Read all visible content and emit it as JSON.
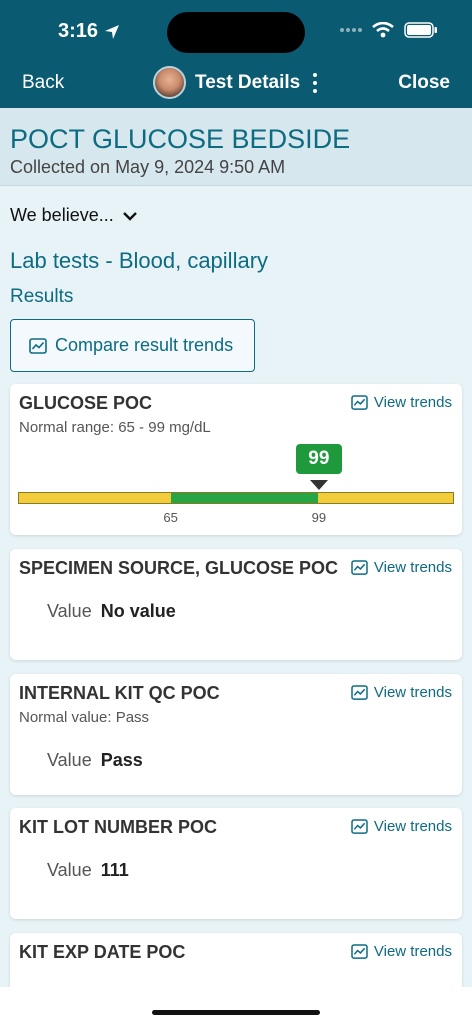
{
  "status_bar": {
    "time": "3:16"
  },
  "nav": {
    "back_label": "Back",
    "title": "Test Details",
    "close_label": "Close"
  },
  "header": {
    "title": "POCT GLUCOSE BEDSIDE",
    "collected": "Collected on May 9, 2024 9:50 AM"
  },
  "believe_label": "We believe...",
  "section_title": "Lab tests - Blood, capillary",
  "results_label": "Results",
  "compare_button_label": "Compare result trends",
  "view_trends_label": "View trends",
  "value_label": "Value",
  "cards": [
    {
      "title": "GLUCOSE POC",
      "subtitle": "Normal range: 65 - 99 mg/dL",
      "result": "99",
      "range_low": "65",
      "range_high": "99",
      "scale": {
        "min": 30,
        "max": 130,
        "low": 65,
        "high": 99,
        "value": 99
      }
    },
    {
      "title": "SPECIMEN SOURCE, GLUCOSE POC",
      "value": "No value"
    },
    {
      "title": "INTERNAL KIT QC POC",
      "subtitle": "Normal value: Pass",
      "value": "Pass"
    },
    {
      "title": "KIT LOT NUMBER POC",
      "value": "111"
    },
    {
      "title": "KIT EXP DATE POC"
    }
  ],
  "colors": {
    "header_bg": "#0a5a72",
    "accent": "#0d6b82",
    "normal_range": "#26a544",
    "out_of_range": "#f2cc3a",
    "result_badge": "#1e9a3c"
  }
}
